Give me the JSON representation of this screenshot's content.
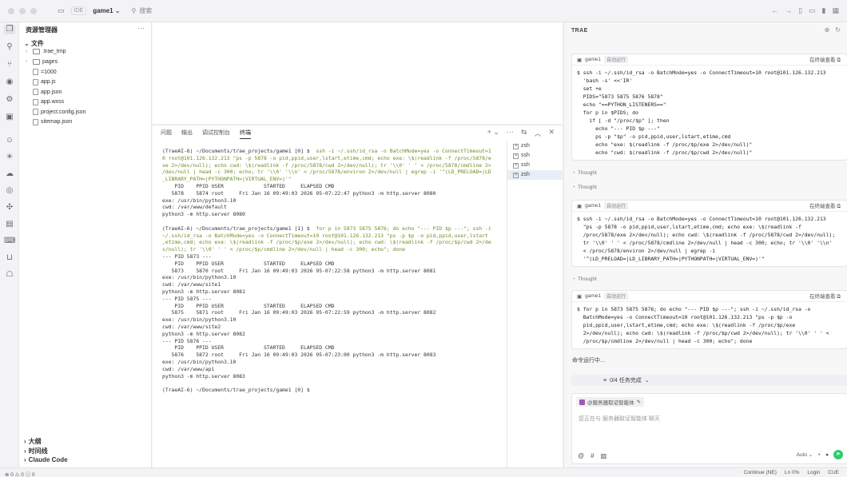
{
  "titlebar": {
    "ide": "IDE",
    "project": "game1",
    "search": "搜索"
  },
  "explorer": {
    "title": "资源管理器",
    "root": "文件",
    "items": [
      {
        "label": ".trae_tmp",
        "type": "folder"
      },
      {
        "label": "pages",
        "type": "folder"
      },
      {
        "label": "=1000",
        "type": "file"
      },
      {
        "label": "app.js",
        "type": "file"
      },
      {
        "label": "app.json",
        "type": "file"
      },
      {
        "label": "app.wxss",
        "type": "file"
      },
      {
        "label": "project.config.json",
        "type": "file"
      },
      {
        "label": "sitemap.json",
        "type": "file"
      }
    ],
    "bottom": [
      "大纲",
      "时间线",
      "Claude Code"
    ]
  },
  "panel": {
    "tabs": [
      "问题",
      "输出",
      "调试控制台",
      "终端"
    ],
    "active_tab": "终端",
    "terminals": [
      "zsh",
      "ssh",
      "ssh",
      "zsh"
    ],
    "terminal_lines": [
      {
        "p": "(TraeAI-6) ~/Documents/trae_projects/game1 [0] $ ",
        "c": " ssh -i ~/.ssh/id_rsa -o BatchMode=yes -o ConnectTimeout=1"
      },
      {
        "c": "0 root@101.126.132.213 \"ps -p 5878 -o pid,ppid,user,lstart,etime,cmd; echo exe: \\$(readlink -f /proc/5878/e"
      },
      {
        "c": "xe 2>/dev/null); echo cwd: \\$(readlink -f /proc/5878/cwd 2>/dev/null); tr '\\\\0' ' ' < /proc/5878/cmdline 2>"
      },
      {
        "c": "/dev/null | head -c 300; echo; tr '\\\\0' '\\\\n' < /proc/5878/environ 2>/dev/null | egrep -i '^(LD_PRELOAD=|LD"
      },
      {
        "c": "_LIBRARY_PATH=|PYTHONPATH=|VIRTUAL_ENV=)'\""
      },
      {
        "t": "    PID    PPID USER             STARTED     ELAPSED CMD"
      },
      {
        "t": "   5878    5874 root     Fri Jan 16 09:49:03 2026 95-07:22:47 python3 -m http.server 8080"
      },
      {
        "t": "exe: /usr/bin/python3.10"
      },
      {
        "t": "cwd: /var/www/default"
      },
      {
        "t": "python3 -m http.server 8080"
      },
      {
        "t": ""
      },
      {
        "p": "(TraeAI-6) ~/Documents/trae_projects/game1 [1] $ ",
        "c": " for p in 5873 5875 5876; do echo \"--- PID $p ---\"; ssh -i"
      },
      {
        "c": "~/.ssh/id_rsa -o BatchMode=yes -o ConnectTimeout=10 root@101.126.132.213 \"ps -p $p -o pid,ppid,user,lstart"
      },
      {
        "c": ",etime,cmd; echo exe: \\$(readlink -f /proc/$p/exe 2>/dev/null); echo cwd: \\$(readlink -f /proc/$p/cwd 2>/de"
      },
      {
        "c": "v/null); tr '\\\\0' ' ' < /proc/$p/cmdline 2>/dev/null | head -c 300; echo\"; done"
      },
      {
        "t": "--- PID 5873 ---"
      },
      {
        "t": "    PID    PPID USER             STARTED     ELAPSED CMD"
      },
      {
        "t": "   5873    5870 root     Fri Jan 16 09:49:03 2026 95-07:22:58 python3 -m http.server 8081"
      },
      {
        "t": "exe: /usr/bin/python3.10"
      },
      {
        "t": "cwd: /var/www/site1"
      },
      {
        "t": "python3 -m http.server 8081"
      },
      {
        "t": "--- PID 5875 ---"
      },
      {
        "t": "    PID    PPID USER             STARTED     ELAPSED CMD"
      },
      {
        "t": "   5875    5871 root     Fri Jan 16 09:49:03 2026 95-07:22:59 python3 -m http.server 8082"
      },
      {
        "t": "exe: /usr/bin/python3.10"
      },
      {
        "t": "cwd: /var/www/site2"
      },
      {
        "t": "python3 -m http.server 8082"
      },
      {
        "t": "--- PID 5876 ---"
      },
      {
        "t": "    PID    PPID USER             STARTED     ELAPSED CMD"
      },
      {
        "t": "   5876    5872 root     Fri Jan 16 09:49:03 2026 95-07:23:00 python3 -m http.server 8083"
      },
      {
        "t": "exe: /usr/bin/python3.10"
      },
      {
        "t": "cwd: /var/www/api"
      },
      {
        "t": "python3 -m http.server 8083"
      },
      {
        "t": ""
      },
      {
        "p": "(TraeAI-6) ~/Documents/trae_projects/game1 [0] $ ",
        "c": ""
      }
    ]
  },
  "chat": {
    "title": "TRAE",
    "blocks": [
      {
        "name": "game1",
        "badge": "自动运行",
        "link": "在终端查看",
        "code": "$ ssh -i ~/.ssh/id_rsa -o BatchMode=yes -o ConnectTimeout=10 root@101.126.132.213\n  'bash -s' <<'IR'\n  set +e\n  PIDS=\"5873 5875 5876 5878\"\n  echo \"==PYTHON_LISTENERS==\"\n  for p in $PIDS; do\n    if [ -d \"/proc/$p\" ]; then\n      echo \"--- PID $p ---\"\n      ps -p \"$p\" -o pid,ppid,user,lstart,etime,cmd\n      echo \"exe: $(readlink -f /proc/$p/exe 2>/dev/null)\"\n      echo \"cwd: $(readlink -f /proc/$p/cwd 2>/dev/null)\""
      },
      {
        "name": "game1",
        "badge": "自动运行",
        "link": "在终端查看",
        "code": "$ ssh -i ~/.ssh/id_rsa -o BatchMode=yes -o ConnectTimeout=10 root@101.126.132.213\n  \"ps -p 5878 -o pid,ppid,user,lstart,etime,cmd; echo exe: \\$(readlink -f\n  /proc/5878/exe 2>/dev/null); echo cwd: \\$(readlink -f /proc/5878/cwd 2>/dev/null);\n  tr '\\\\0' ' ' < /proc/5878/cmdline 2>/dev/null | head -c 300; echo; tr '\\\\0' '\\\\n'\n  < /proc/5878/environ 2>/dev/null | egrep -i\n  '^(LD_PRELOAD=|LD_LIBRARY_PATH=|PYTHONPATH=|VIRTUAL_ENV=)'\""
      },
      {
        "name": "game1",
        "badge": "自动运行",
        "link": "在终端查看",
        "code": "$ for p in 5873 5875 5876; do echo \"--- PID $p ---\"; ssh -i ~/.ssh/id_rsa -o\n  BatchMode=yes -o ConnectTimeout=10 root@101.126.132.213 \"ps -p $p -o\n  pid,ppid,user,lstart,etime,cmd; echo exe: \\$(readlink -f /proc/$p/exe\n  2>/dev/null); echo cwd: \\$(readlink -f /proc/$p/cwd 2>/dev/null); tr '\\\\0' ' ' <\n  /proc/$p/cmdline 2>/dev/null | head -c 300; echo\"; done"
      }
    ],
    "thought_label": "Thought",
    "running": "命令运行中...",
    "tasks": "0/4 任务完成",
    "agent": "@服务器取证智能体",
    "placeholder": "您正在与 服务器取证智能体 聊天",
    "model": "Auto"
  },
  "statusbar": {
    "left": "⊗ 0 ⚠ 0 ⓘ 0",
    "right": [
      "Continue (NE)",
      "Ln 0%",
      "Login",
      "CUE"
    ]
  }
}
